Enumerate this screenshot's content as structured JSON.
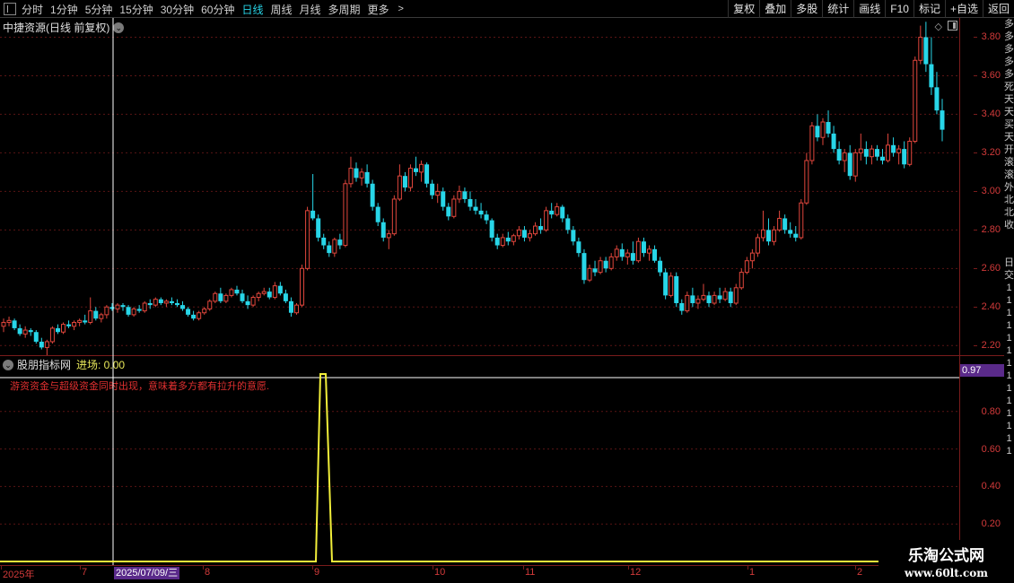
{
  "toolbar": {
    "periods": [
      "分时",
      "1分钟",
      "5分钟",
      "15分钟",
      "30分钟",
      "60分钟",
      "日线",
      "周线",
      "月线",
      "多周期",
      "更多"
    ],
    "active_period": "日线",
    "buttons": [
      "复权",
      "叠加",
      "多股",
      "统计",
      "画线",
      "F10",
      "标记",
      "+自选",
      "返回"
    ]
  },
  "main": {
    "title": "中捷资源(日线 前复权)",
    "price_ticks": [
      "3.80",
      "3.60",
      "3.40",
      "3.20",
      "3.00",
      "2.80",
      "2.60",
      "2.40",
      "2.20"
    ]
  },
  "indicator": {
    "name": "股朋指标网",
    "line_label": "进场: 0.00",
    "description": "游资资金与超级资金同时出现，意味着多方都有拉升的意愿.",
    "value_badge": "0.97",
    "ticks": [
      "0.80",
      "0.60",
      "0.40",
      "0.20"
    ]
  },
  "date_axis": {
    "labels": [
      "2025年",
      "7",
      "8",
      "9",
      "10",
      "11",
      "12",
      "1",
      "2"
    ],
    "cursor_date": "2025/07/09/三"
  },
  "right_strip": [
    "多",
    "多",
    "多",
    "多",
    "多",
    "死",
    "天",
    "天",
    "买",
    "天",
    "开",
    "滚",
    "滚",
    "外",
    "北",
    "北",
    "收",
    "",
    "",
    "日",
    "交",
    "1",
    "1",
    "1",
    "1",
    "1",
    "1",
    "1",
    "1",
    "1",
    "1",
    "1",
    "1",
    "1",
    "1"
  ],
  "watermark": {
    "title": "乐淘公式网",
    "url": "www.60lt.com"
  },
  "colors": {
    "up": "#e0463c",
    "down": "#28d6e8",
    "indicator_line": "#f2ef3a",
    "axis": "#7a1c1c",
    "cursor": "#ffffff",
    "badge": "#5a2a8a"
  },
  "chart_data": {
    "type": "candlestick",
    "title": "中捷资源(日线 前复权)",
    "ylim": [
      2.15,
      3.9
    ],
    "dates_range": [
      "2025-06",
      "2026-02"
    ],
    "indicator": {
      "name": "进场",
      "peak_value": 1.0,
      "peak_date": "2025-09",
      "baseline": 0.0
    },
    "ohlc": [
      [
        2.3,
        2.34,
        2.27,
        2.32
      ],
      [
        2.32,
        2.35,
        2.3,
        2.33
      ],
      [
        2.33,
        2.34,
        2.28,
        2.29
      ],
      [
        2.29,
        2.31,
        2.25,
        2.26
      ],
      [
        2.26,
        2.3,
        2.24,
        2.28
      ],
      [
        2.28,
        2.29,
        2.25,
        2.27
      ],
      [
        2.27,
        2.28,
        2.21,
        2.22
      ],
      [
        2.22,
        2.24,
        2.18,
        2.19
      ],
      [
        2.19,
        2.23,
        2.15,
        2.22
      ],
      [
        2.22,
        2.3,
        2.21,
        2.29
      ],
      [
        2.29,
        2.31,
        2.26,
        2.27
      ],
      [
        2.27,
        2.32,
        2.26,
        2.31
      ],
      [
        2.31,
        2.33,
        2.29,
        2.3
      ],
      [
        2.3,
        2.33,
        2.28,
        2.32
      ],
      [
        2.32,
        2.34,
        2.3,
        2.33
      ],
      [
        2.33,
        2.36,
        2.31,
        2.32
      ],
      [
        2.32,
        2.45,
        2.31,
        2.38
      ],
      [
        2.38,
        2.4,
        2.33,
        2.34
      ],
      [
        2.34,
        2.37,
        2.32,
        2.36
      ],
      [
        2.36,
        2.41,
        2.34,
        2.4
      ],
      [
        2.4,
        2.42,
        2.38,
        2.39
      ],
      [
        2.39,
        2.42,
        2.37,
        2.41
      ],
      [
        2.41,
        2.42,
        2.38,
        2.4
      ],
      [
        2.4,
        2.41,
        2.35,
        2.36
      ],
      [
        2.36,
        2.4,
        2.35,
        2.39
      ],
      [
        2.39,
        2.41,
        2.37,
        2.38
      ],
      [
        2.38,
        2.43,
        2.37,
        2.42
      ],
      [
        2.42,
        2.44,
        2.39,
        2.41
      ],
      [
        2.41,
        2.45,
        2.4,
        2.44
      ],
      [
        2.44,
        2.45,
        2.41,
        2.42
      ],
      [
        2.42,
        2.44,
        2.4,
        2.43
      ],
      [
        2.43,
        2.45,
        2.41,
        2.42
      ],
      [
        2.42,
        2.44,
        2.4,
        2.41
      ],
      [
        2.41,
        2.43,
        2.38,
        2.39
      ],
      [
        2.39,
        2.4,
        2.35,
        2.36
      ],
      [
        2.36,
        2.38,
        2.33,
        2.34
      ],
      [
        2.34,
        2.38,
        2.33,
        2.37
      ],
      [
        2.37,
        2.4,
        2.36,
        2.39
      ],
      [
        2.39,
        2.44,
        2.38,
        2.43
      ],
      [
        2.43,
        2.48,
        2.42,
        2.47
      ],
      [
        2.47,
        2.5,
        2.42,
        2.43
      ],
      [
        2.43,
        2.47,
        2.42,
        2.46
      ],
      [
        2.46,
        2.5,
        2.45,
        2.49
      ],
      [
        2.49,
        2.51,
        2.46,
        2.47
      ],
      [
        2.47,
        2.49,
        2.42,
        2.43
      ],
      [
        2.43,
        2.46,
        2.39,
        2.41
      ],
      [
        2.41,
        2.46,
        2.4,
        2.45
      ],
      [
        2.45,
        2.48,
        2.43,
        2.47
      ],
      [
        2.47,
        2.5,
        2.46,
        2.48
      ],
      [
        2.48,
        2.5,
        2.44,
        2.45
      ],
      [
        2.45,
        2.53,
        2.44,
        2.51
      ],
      [
        2.51,
        2.53,
        2.46,
        2.47
      ],
      [
        2.47,
        2.49,
        2.42,
        2.43
      ],
      [
        2.43,
        2.45,
        2.35,
        2.37
      ],
      [
        2.37,
        2.42,
        2.36,
        2.41
      ],
      [
        2.41,
        2.62,
        2.4,
        2.6
      ],
      [
        2.6,
        2.92,
        2.59,
        2.9
      ],
      [
        2.9,
        3.09,
        2.85,
        2.86
      ],
      [
        2.86,
        2.88,
        2.74,
        2.76
      ],
      [
        2.76,
        2.78,
        2.7,
        2.72
      ],
      [
        2.72,
        2.74,
        2.66,
        2.68
      ],
      [
        2.68,
        2.76,
        2.66,
        2.75
      ],
      [
        2.75,
        2.78,
        2.7,
        2.72
      ],
      [
        2.72,
        3.06,
        2.71,
        3.04
      ],
      [
        3.04,
        3.18,
        3.02,
        3.12
      ],
      [
        3.12,
        3.15,
        3.05,
        3.07
      ],
      [
        3.07,
        3.12,
        3.03,
        3.1
      ],
      [
        3.1,
        3.14,
        3.02,
        3.04
      ],
      [
        3.04,
        3.06,
        2.9,
        2.92
      ],
      [
        2.92,
        2.94,
        2.82,
        2.84
      ],
      [
        2.84,
        2.86,
        2.74,
        2.76
      ],
      [
        2.76,
        2.8,
        2.7,
        2.78
      ],
      [
        2.78,
        2.98,
        2.77,
        2.96
      ],
      [
        2.96,
        3.14,
        2.95,
        3.08
      ],
      [
        3.08,
        3.1,
        3.0,
        3.02
      ],
      [
        3.02,
        3.14,
        3.0,
        3.12
      ],
      [
        3.12,
        3.18,
        3.08,
        3.1
      ],
      [
        3.1,
        3.16,
        3.05,
        3.14
      ],
      [
        3.14,
        3.15,
        3.02,
        3.04
      ],
      [
        3.04,
        3.06,
        2.96,
        2.98
      ],
      [
        2.98,
        3.04,
        2.94,
        3.0
      ],
      [
        3.0,
        3.02,
        2.9,
        2.92
      ],
      [
        2.92,
        2.94,
        2.85,
        2.87
      ],
      [
        2.87,
        2.98,
        2.86,
        2.96
      ],
      [
        2.96,
        3.03,
        2.94,
        3.0
      ],
      [
        3.0,
        3.02,
        2.94,
        2.96
      ],
      [
        2.96,
        3.0,
        2.9,
        2.92
      ],
      [
        2.92,
        2.96,
        2.88,
        2.9
      ],
      [
        2.9,
        2.94,
        2.86,
        2.88
      ],
      [
        2.88,
        2.9,
        2.83,
        2.85
      ],
      [
        2.85,
        2.86,
        2.74,
        2.76
      ],
      [
        2.76,
        2.78,
        2.7,
        2.72
      ],
      [
        2.72,
        2.78,
        2.71,
        2.76
      ],
      [
        2.76,
        2.79,
        2.72,
        2.74
      ],
      [
        2.74,
        2.78,
        2.72,
        2.77
      ],
      [
        2.77,
        2.82,
        2.75,
        2.8
      ],
      [
        2.8,
        2.82,
        2.74,
        2.76
      ],
      [
        2.76,
        2.8,
        2.74,
        2.78
      ],
      [
        2.78,
        2.84,
        2.77,
        2.82
      ],
      [
        2.82,
        2.86,
        2.78,
        2.8
      ],
      [
        2.8,
        2.92,
        2.79,
        2.9
      ],
      [
        2.9,
        2.94,
        2.86,
        2.88
      ],
      [
        2.88,
        2.94,
        2.87,
        2.92
      ],
      [
        2.92,
        2.93,
        2.84,
        2.86
      ],
      [
        2.86,
        2.88,
        2.78,
        2.8
      ],
      [
        2.8,
        2.82,
        2.72,
        2.74
      ],
      [
        2.74,
        2.76,
        2.66,
        2.68
      ],
      [
        2.68,
        2.7,
        2.52,
        2.54
      ],
      [
        2.54,
        2.62,
        2.53,
        2.6
      ],
      [
        2.6,
        2.64,
        2.56,
        2.58
      ],
      [
        2.58,
        2.66,
        2.57,
        2.64
      ],
      [
        2.64,
        2.66,
        2.58,
        2.6
      ],
      [
        2.6,
        2.68,
        2.59,
        2.66
      ],
      [
        2.66,
        2.72,
        2.64,
        2.7
      ],
      [
        2.7,
        2.73,
        2.64,
        2.66
      ],
      [
        2.66,
        2.7,
        2.62,
        2.68
      ],
      [
        2.68,
        2.74,
        2.62,
        2.64
      ],
      [
        2.64,
        2.76,
        2.63,
        2.74
      ],
      [
        2.74,
        2.76,
        2.66,
        2.68
      ],
      [
        2.68,
        2.72,
        2.64,
        2.7
      ],
      [
        2.7,
        2.72,
        2.63,
        2.64
      ],
      [
        2.64,
        2.66,
        2.56,
        2.58
      ],
      [
        2.58,
        2.6,
        2.44,
        2.46
      ],
      [
        2.46,
        2.58,
        2.45,
        2.56
      ],
      [
        2.56,
        2.58,
        2.4,
        2.42
      ],
      [
        2.42,
        2.44,
        2.36,
        2.38
      ],
      [
        2.38,
        2.48,
        2.37,
        2.46
      ],
      [
        2.46,
        2.5,
        2.4,
        2.42
      ],
      [
        2.42,
        2.46,
        2.39,
        2.44
      ],
      [
        2.44,
        2.52,
        2.43,
        2.46
      ],
      [
        2.46,
        2.48,
        2.4,
        2.42
      ],
      [
        2.42,
        2.48,
        2.41,
        2.46
      ],
      [
        2.46,
        2.5,
        2.42,
        2.44
      ],
      [
        2.44,
        2.5,
        2.43,
        2.48
      ],
      [
        2.48,
        2.5,
        2.4,
        2.42
      ],
      [
        2.42,
        2.52,
        2.41,
        2.5
      ],
      [
        2.5,
        2.6,
        2.49,
        2.58
      ],
      [
        2.58,
        2.66,
        2.57,
        2.64
      ],
      [
        2.64,
        2.7,
        2.6,
        2.68
      ],
      [
        2.68,
        2.78,
        2.66,
        2.76
      ],
      [
        2.76,
        2.9,
        2.74,
        2.8
      ],
      [
        2.8,
        2.86,
        2.72,
        2.74
      ],
      [
        2.74,
        2.82,
        2.72,
        2.8
      ],
      [
        2.8,
        2.9,
        2.79,
        2.86
      ],
      [
        2.86,
        2.88,
        2.78,
        2.8
      ],
      [
        2.8,
        2.84,
        2.76,
        2.78
      ],
      [
        2.78,
        2.82,
        2.74,
        2.76
      ],
      [
        2.76,
        2.96,
        2.75,
        2.94
      ],
      [
        2.94,
        3.2,
        2.93,
        3.16
      ],
      [
        3.16,
        3.36,
        3.14,
        3.34
      ],
      [
        3.34,
        3.4,
        3.26,
        3.28
      ],
      [
        3.28,
        3.38,
        3.24,
        3.36
      ],
      [
        3.36,
        3.42,
        3.28,
        3.3
      ],
      [
        3.3,
        3.34,
        3.2,
        3.22
      ],
      [
        3.22,
        3.26,
        3.14,
        3.16
      ],
      [
        3.16,
        3.22,
        3.1,
        3.2
      ],
      [
        3.2,
        3.24,
        3.06,
        3.08
      ],
      [
        3.08,
        3.22,
        3.05,
        3.2
      ],
      [
        3.2,
        3.3,
        3.16,
        3.22
      ],
      [
        3.22,
        3.26,
        3.14,
        3.18
      ],
      [
        3.18,
        3.24,
        3.14,
        3.22
      ],
      [
        3.22,
        3.24,
        3.16,
        3.18
      ],
      [
        3.18,
        3.22,
        3.14,
        3.16
      ],
      [
        3.16,
        3.3,
        3.15,
        3.24
      ],
      [
        3.24,
        3.28,
        3.18,
        3.2
      ],
      [
        3.2,
        3.24,
        3.14,
        3.22
      ],
      [
        3.22,
        3.26,
        3.12,
        3.14
      ],
      [
        3.14,
        3.28,
        3.13,
        3.26
      ],
      [
        3.26,
        3.7,
        3.25,
        3.68
      ],
      [
        3.68,
        3.86,
        3.66,
        3.8
      ],
      [
        3.8,
        3.88,
        3.62,
        3.66
      ],
      [
        3.66,
        3.8,
        3.5,
        3.54
      ],
      [
        3.54,
        3.62,
        3.4,
        3.42
      ],
      [
        3.42,
        3.48,
        3.26,
        3.32
      ]
    ]
  }
}
